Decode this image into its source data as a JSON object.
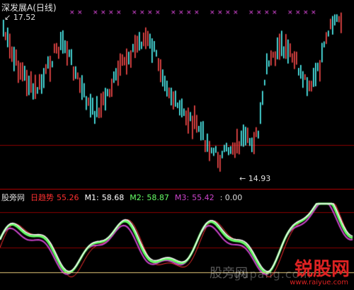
{
  "title": "深发展A(日线)",
  "price": {
    "high_label": "17.52",
    "low_label": "14.93"
  },
  "indicator": {
    "name": "股旁网",
    "trend_label": "日趋势",
    "trend_value": "55.26",
    "m1_label": "M1:",
    "m1_value": "58.68",
    "m2_label": "M2:",
    "m2_value": "58.87",
    "m3_label": "M3:",
    "m3_value": "55.42",
    "extra": ": 0.00"
  },
  "watermark": {
    "cn": "股旁网",
    "latin": "gupang.com",
    "brand": "锐股网",
    "url": "www.raiyue.com"
  },
  "colors": {
    "up": "#ff4d4d",
    "down": "#54ffff",
    "trend": "#ff3030",
    "m1": "#ffffff",
    "m2": "#66ff66",
    "m3": "#cc44cc",
    "baseline": "#e6c878",
    "marker": "#ff55ff",
    "grid": "#8b0000"
  }
}
